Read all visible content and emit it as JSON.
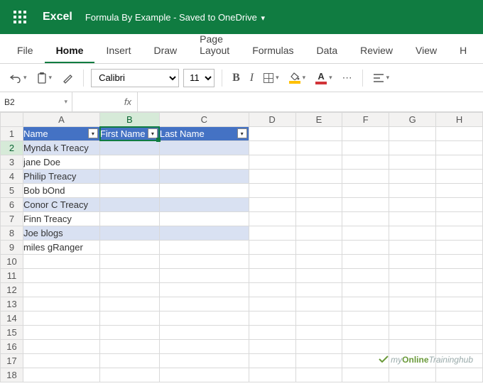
{
  "title_bar": {
    "app_name": "Excel",
    "doc_title": "Formula By Example - Saved to OneDrive"
  },
  "tabs": {
    "file": "File",
    "home": "Home",
    "insert": "Insert",
    "draw": "Draw",
    "page_layout": "Page Layout",
    "formulas": "Formulas",
    "data": "Data",
    "review": "Review",
    "view": "View",
    "help": "H"
  },
  "toolbar": {
    "font_name": "Calibri",
    "font_size": "11",
    "bold": "B",
    "italic": "I",
    "font_color_letter": "A",
    "more": "⋯"
  },
  "namebox": {
    "ref": "B2"
  },
  "fx_label": "fx",
  "columns": [
    "A",
    "B",
    "C",
    "D",
    "E",
    "F",
    "G",
    "H"
  ],
  "table": {
    "headers": {
      "name": "Name",
      "first": "First Name",
      "last": "Last Name"
    },
    "rows": [
      "Mynda k Treacy",
      "jane Doe",
      "Philip Treacy",
      "Bob bOnd",
      "Conor C Treacy",
      "Finn Treacy",
      "Joe blogs",
      "miles gRanger"
    ]
  },
  "watermark": {
    "pre": "my",
    "brand": "Online",
    "post": "Traininghub"
  },
  "active_cell": "B2",
  "colors": {
    "brand": "#107c41",
    "table_header": "#4472C4",
    "band": "#D9E1F2"
  }
}
